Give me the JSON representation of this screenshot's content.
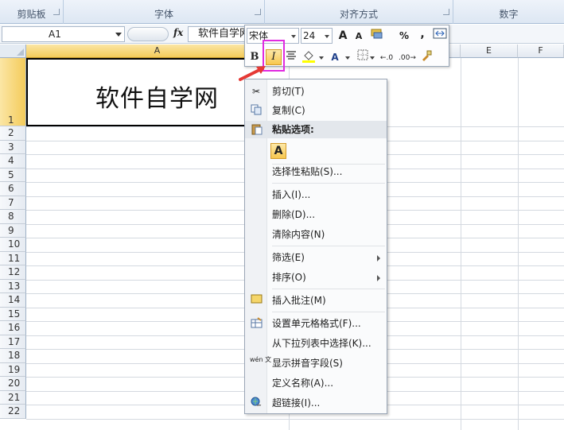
{
  "ribbon": {
    "groups": [
      {
        "label": "剪贴板"
      },
      {
        "label": "字体"
      },
      {
        "label": "对齐方式"
      },
      {
        "label": "数字"
      }
    ]
  },
  "formula_bar": {
    "name_box": "A1",
    "fx_label": "fx",
    "formula": "软件自学网"
  },
  "columns": [
    "A",
    "E",
    "F"
  ],
  "rows": [
    "1",
    "2",
    "3",
    "4",
    "5",
    "6",
    "7",
    "8",
    "9",
    "10",
    "11",
    "12",
    "13",
    "14",
    "15",
    "16",
    "17",
    "18",
    "19",
    "20",
    "21",
    "22"
  ],
  "cell_a1": "软件自学网",
  "mini_toolbar": {
    "font_name": "宋体",
    "font_size": "24",
    "grow": "A",
    "shrink": "A",
    "percent": "%",
    "comma": ",",
    "bold": "B",
    "italic": "I",
    "font_color": "A",
    "dec_inc": "←.0",
    "dec_dec": ".00→"
  },
  "context_menu": {
    "cut": "剪切(T)",
    "copy": "复制(C)",
    "paste_options": "粘贴选项:",
    "paste_icon": "A",
    "paste_special": "选择性粘贴(S)...",
    "insert": "插入(I)...",
    "delete": "删除(D)...",
    "clear": "清除内容(N)",
    "filter": "筛选(E)",
    "sort": "排序(O)",
    "insert_comment": "插入批注(M)",
    "format_cells": "设置单元格格式(F)...",
    "pick_list": "从下拉列表中选择(K)...",
    "phonetic": "显示拼音字段(S)",
    "define_name": "定义名称(A)...",
    "hyperlink": "超链接(I)...",
    "phonetic_icon": "wén 文"
  },
  "colors": {
    "highlight": "#e02be0",
    "selected_header": "#f4cb5a",
    "arrow": "#e53935"
  }
}
